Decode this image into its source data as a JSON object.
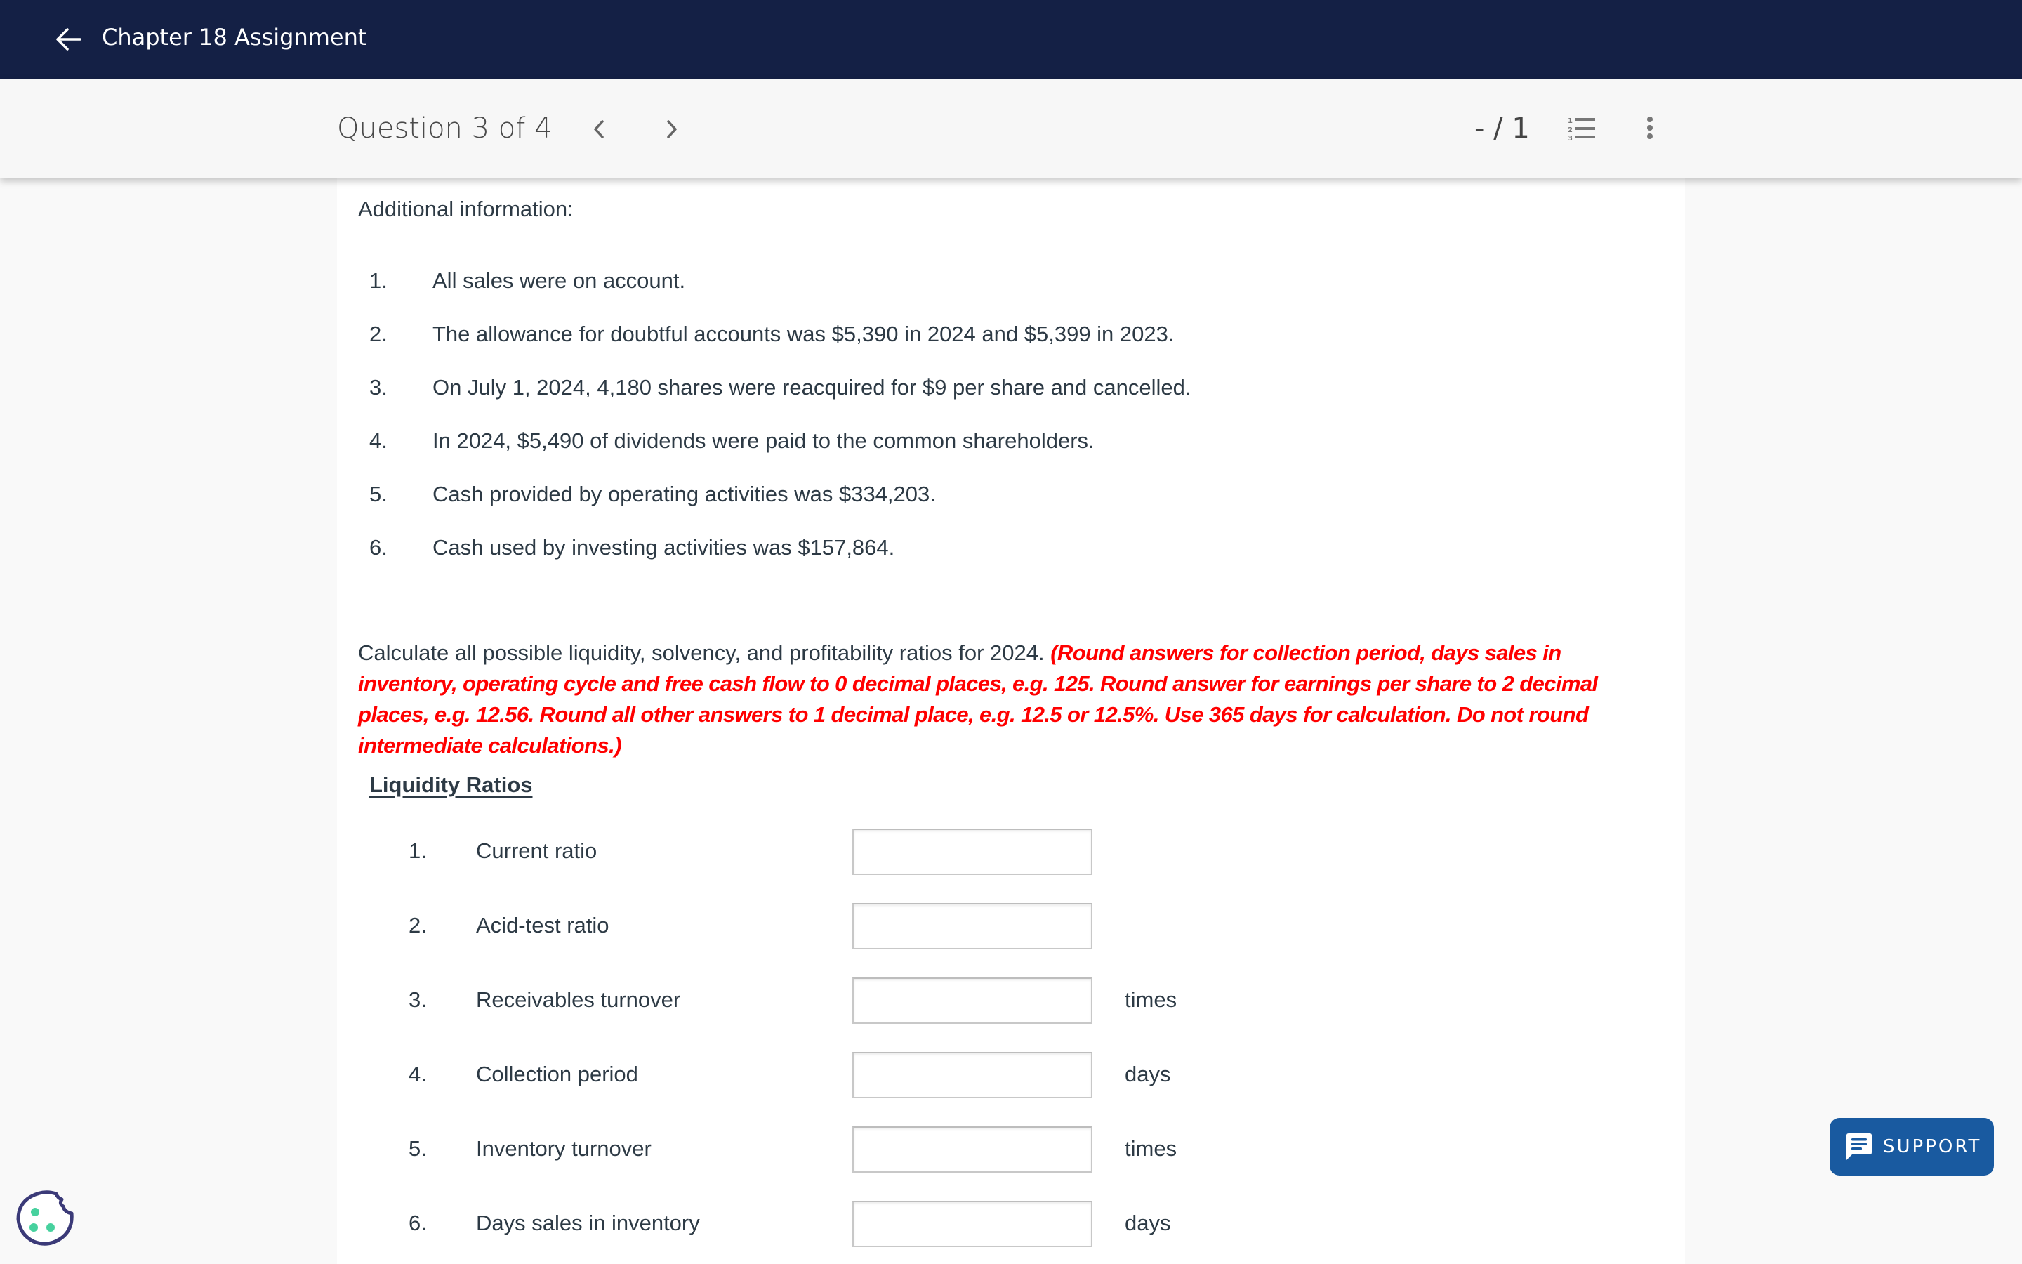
{
  "topbar": {
    "title": "Chapter 18 Assignment",
    "back_icon": "arrow-left-icon"
  },
  "question_bar": {
    "label": "Question 3 of 4",
    "prev_icon": "chevron-left-icon",
    "next_icon": "chevron-right-icon",
    "score": "- / 1",
    "list_icon": "numbered-list-icon",
    "more_icon": "more-vertical-icon"
  },
  "content": {
    "additional_info_heading": "Additional information:",
    "additional_info": [
      {
        "num": "1.",
        "text": "All sales were on account."
      },
      {
        "num": "2.",
        "text": "The allowance for doubtful accounts was $5,390 in 2024 and $5,399 in 2023."
      },
      {
        "num": "3.",
        "text": "On July 1, 2024, 4,180 shares were reacquired for $9 per share and cancelled."
      },
      {
        "num": "4.",
        "text": "In 2024, $5,490 of dividends were paid to the common shareholders."
      },
      {
        "num": "5.",
        "text": "Cash provided by operating activities was $334,203."
      },
      {
        "num": "6.",
        "text": "Cash used by investing activities was $157,864."
      }
    ],
    "instruction_text": "Calculate all possible liquidity, solvency, and profitability ratios for 2024. ",
    "instruction_note": "(Round answers for collection period, days sales in inventory, operating cycle and free cash flow to 0 decimal places, e.g. 125. Round answer for earnings per share to 2 decimal places, e.g. 12.56. Round all other answers to 1 decimal place, e.g. 12.5 or 12.5%. Use 365 days for calculation. Do not round intermediate calculations.)",
    "instruction_note_color": "#ff0000",
    "section_title": "Liquidity Ratios",
    "ratios": [
      {
        "num": "1.",
        "label": "Current ratio",
        "value": "",
        "unit": ""
      },
      {
        "num": "2.",
        "label": "Acid-test ratio",
        "value": "",
        "unit": ""
      },
      {
        "num": "3.",
        "label": "Receivables turnover",
        "value": "",
        "unit": "times"
      },
      {
        "num": "4.",
        "label": "Collection period",
        "value": "",
        "unit": "days"
      },
      {
        "num": "5.",
        "label": "Inventory turnover",
        "value": "",
        "unit": "times"
      },
      {
        "num": "6.",
        "label": "Days sales in inventory",
        "value": "",
        "unit": "days"
      }
    ]
  },
  "support": {
    "label": "SUPPORT",
    "icon": "chat-icon",
    "color": "#195aa0"
  },
  "cookie": {
    "icon": "cookie-icon"
  },
  "colors": {
    "topbar": "#142045",
    "accent_red": "#ff0000"
  }
}
